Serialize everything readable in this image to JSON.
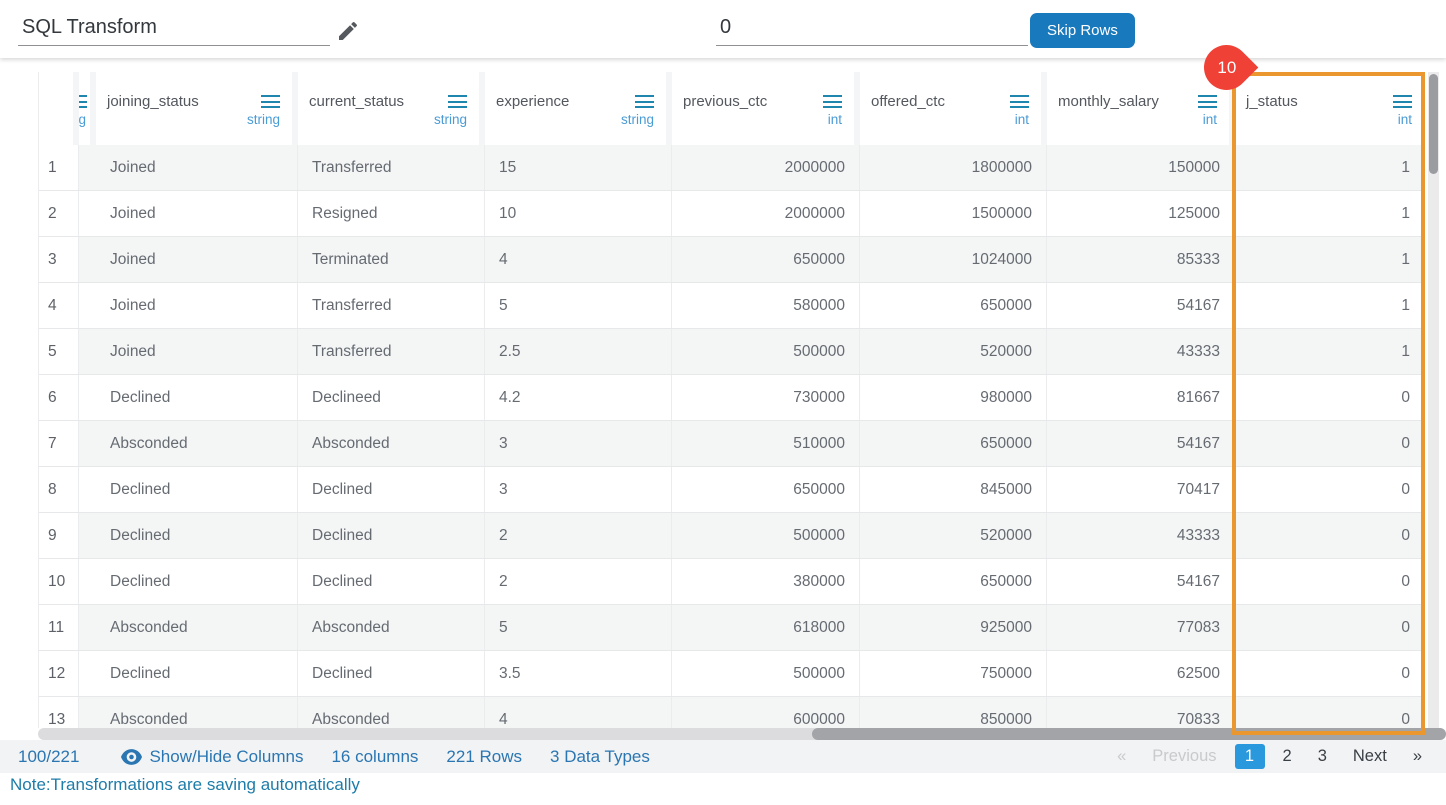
{
  "topbar": {
    "title": "SQL Transform",
    "skip_input_value": "0",
    "skip_button_label": "Skip Rows"
  },
  "table": {
    "clipped_column": {
      "type_fragment": "g"
    },
    "columns": [
      {
        "name": "joining_status",
        "type": "string",
        "align": "left"
      },
      {
        "name": "current_status",
        "type": "string",
        "align": "left"
      },
      {
        "name": "experience",
        "type": "string",
        "align": "left"
      },
      {
        "name": "previous_ctc",
        "type": "int",
        "align": "right"
      },
      {
        "name": "offered_ctc",
        "type": "int",
        "align": "right"
      },
      {
        "name": "monthly_salary",
        "type": "int",
        "align": "right"
      },
      {
        "name": "j_status",
        "type": "int",
        "align": "right",
        "highlighted": true
      }
    ],
    "rows": [
      {
        "num": "1",
        "cells": [
          "Joined",
          "Transferred",
          "15",
          "2000000",
          "1800000",
          "150000",
          "1"
        ]
      },
      {
        "num": "2",
        "cells": [
          "Joined",
          "Resigned",
          "10",
          "2000000",
          "1500000",
          "125000",
          "1"
        ]
      },
      {
        "num": "3",
        "cells": [
          "Joined",
          "Terminated",
          "4",
          "650000",
          "1024000",
          "85333",
          "1"
        ]
      },
      {
        "num": "4",
        "cells": [
          "Joined",
          "Transferred",
          "5",
          "580000",
          "650000",
          "54167",
          "1"
        ]
      },
      {
        "num": "5",
        "cells": [
          "Joined",
          "Transferred",
          "2.5",
          "500000",
          "520000",
          "43333",
          "1"
        ]
      },
      {
        "num": "6",
        "cells": [
          "Declined",
          "Declineed",
          "4.2",
          "730000",
          "980000",
          "81667",
          "0"
        ]
      },
      {
        "num": "7",
        "cells": [
          "Absconded",
          "Absconded",
          "3",
          "510000",
          "650000",
          "54167",
          "0"
        ]
      },
      {
        "num": "8",
        "cells": [
          "Declined",
          "Declined",
          "3",
          "650000",
          "845000",
          "70417",
          "0"
        ]
      },
      {
        "num": "9",
        "cells": [
          "Declined",
          "Declined",
          "2",
          "500000",
          "520000",
          "43333",
          "0"
        ]
      },
      {
        "num": "10",
        "cells": [
          "Declined",
          "Declined",
          "2",
          "380000",
          "650000",
          "54167",
          "0"
        ]
      },
      {
        "num": "11",
        "cells": [
          "Absconded",
          "Absconded",
          "5",
          "618000",
          "925000",
          "77083",
          "0"
        ]
      },
      {
        "num": "12",
        "cells": [
          "Declined",
          "Declined",
          "3.5",
          "500000",
          "750000",
          "62500",
          "0"
        ]
      },
      {
        "num": "13",
        "cells": [
          "Absconded",
          "Absconded",
          "4",
          "600000",
          "850000",
          "70833",
          "0"
        ]
      }
    ],
    "highlight_badge": "10"
  },
  "footer": {
    "page_fraction": "100/221",
    "show_hide_label": "Show/Hide Columns",
    "columns_count": "16 columns",
    "rows_count": "221 Rows",
    "datatypes_count": "3 Data Types",
    "pagination": {
      "prev_arrow": "«",
      "previous_label": "Previous",
      "pages": [
        "1",
        "2",
        "3"
      ],
      "active_page": "1",
      "next_label": "Next",
      "next_arrow": "»"
    }
  },
  "note": "Note:Transformations are saving automatically",
  "colors": {
    "button_blue": "#1879bd",
    "active_page_blue": "#2a98dd",
    "link_blue": "#2a76b2",
    "type_label_blue": "#4b9bd5",
    "menu_icon_teal": "#1f86ae",
    "highlight_orange": "#e9972e",
    "badge_red": "#f04137",
    "stripe_gray": "#f4f5f5",
    "note_blue": "#1e7ca9"
  }
}
